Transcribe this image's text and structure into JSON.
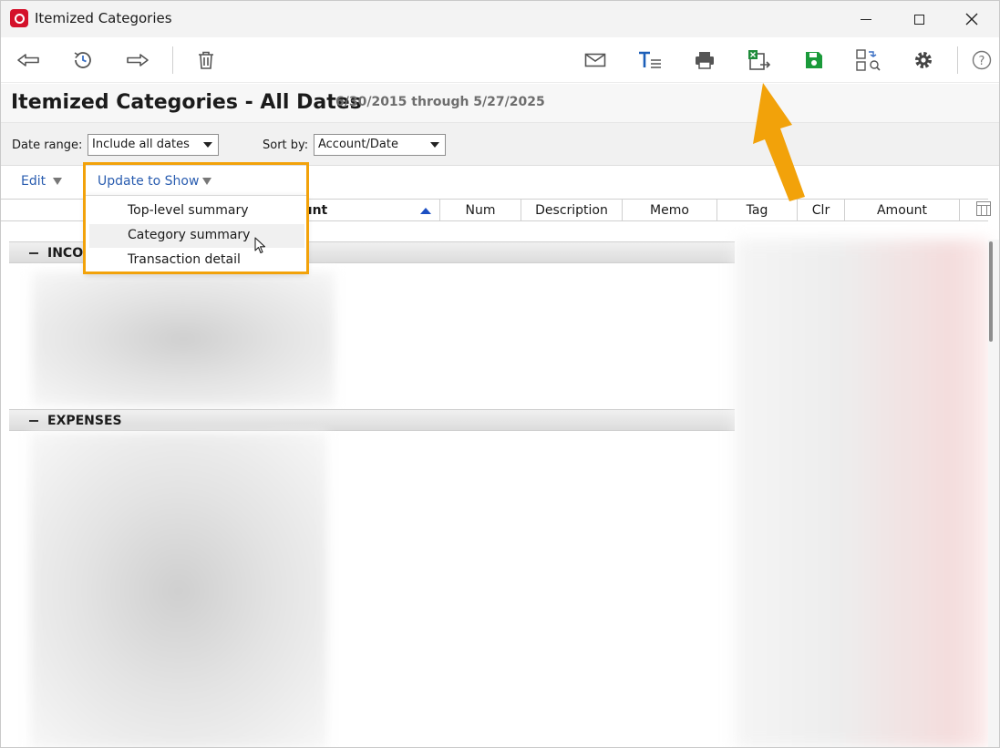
{
  "window": {
    "title": "Itemized Categories",
    "controls": {
      "minimize": "—",
      "maximize": "□",
      "close": "✕"
    }
  },
  "toolbar": {
    "icons": [
      "back-arrow-icon",
      "history-icon",
      "forward-arrow-icon",
      "trash-icon",
      "mail-icon",
      "text-format-icon",
      "print-icon",
      "export-excel-icon",
      "save-icon",
      "find-replace-icon",
      "gear-icon",
      "help-icon"
    ],
    "help_label": "?"
  },
  "report": {
    "title": "Itemized Categories - All Dates",
    "range": "6/30/2015 through 5/27/2025"
  },
  "filters": {
    "date_range_label": "Date range:",
    "date_range_value": "Include all dates",
    "sort_by_label": "Sort by:",
    "sort_by_value": "Account/Date"
  },
  "actions": {
    "edit_label": "Edit",
    "update_label": "Update to Show"
  },
  "columns": {
    "account": "ount",
    "num": "Num",
    "description": "Description",
    "memo": "Memo",
    "tag": "Tag",
    "clr": "Clr",
    "amount": "Amount"
  },
  "sections": {
    "income": "INCO",
    "expenses": "EXPENSES"
  },
  "menu": {
    "items": [
      "Top-level summary",
      "Category summary",
      "Transaction detail"
    ],
    "hovered_index": 1
  },
  "colors": {
    "highlight": "#f2a20a",
    "link": "#2a5db0",
    "brand": "#d4112a",
    "excel_green": "#1e8c3a",
    "save_green": "#1a9a3a"
  }
}
